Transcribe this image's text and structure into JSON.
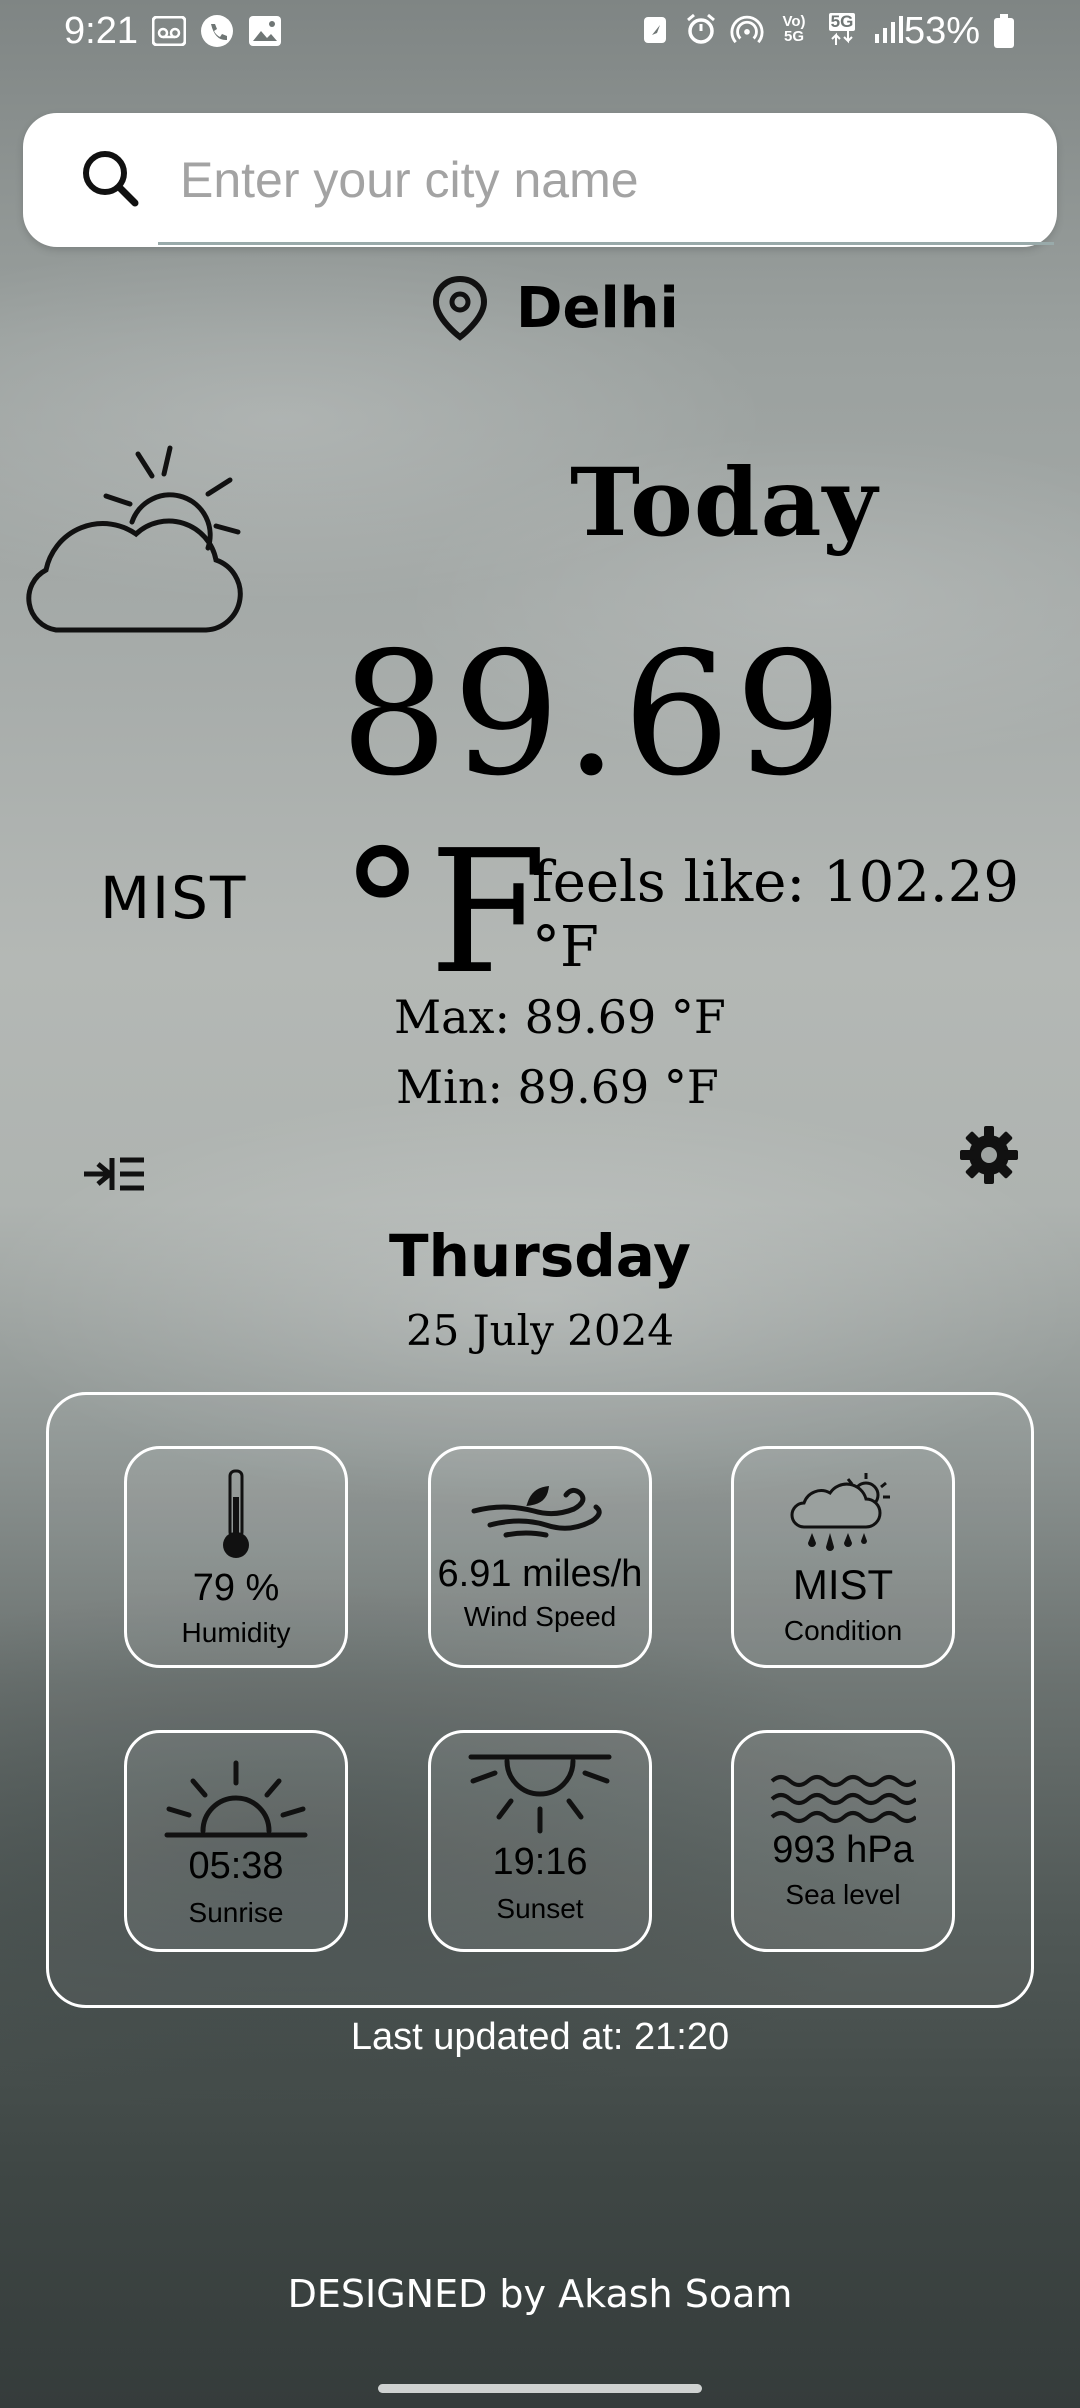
{
  "status": {
    "time": "9:21",
    "battery": "53%",
    "network": "5G"
  },
  "search": {
    "placeholder": "Enter your city name",
    "value": ""
  },
  "location": {
    "city": "Delhi"
  },
  "today": {
    "label": "Today",
    "temperature": "89.69 °F",
    "condition": "MIST",
    "feels_like": "feels like: 102.29 °F",
    "max": "Max: 89.69 °F",
    "min": "Min: 89.69 °F"
  },
  "date": {
    "day": "Thursday",
    "full": "25 July 2024"
  },
  "stats": {
    "humidity": {
      "value": "79 %",
      "label": "Humidity",
      "icon": "thermometer-icon"
    },
    "wind": {
      "value": "6.91 miles/h",
      "label": "Wind Speed",
      "icon": "wind-icon"
    },
    "condition": {
      "value": "MIST",
      "label": "Condition",
      "icon": "cloud-rain-sun-icon"
    },
    "sunrise": {
      "value": "05:38",
      "label": "Sunrise",
      "icon": "sunrise-icon"
    },
    "sunset": {
      "value": "19:16",
      "label": "Sunset",
      "icon": "sunset-icon"
    },
    "sea_level": {
      "value": "993 hPa",
      "label": "Sea level",
      "icon": "waves-icon"
    }
  },
  "footer": {
    "last_updated": "Last updated at: 21:20",
    "credits": "DESIGNED by Akash Soam"
  },
  "colors": {
    "card_border": "#ffffff",
    "text": "#000000"
  }
}
